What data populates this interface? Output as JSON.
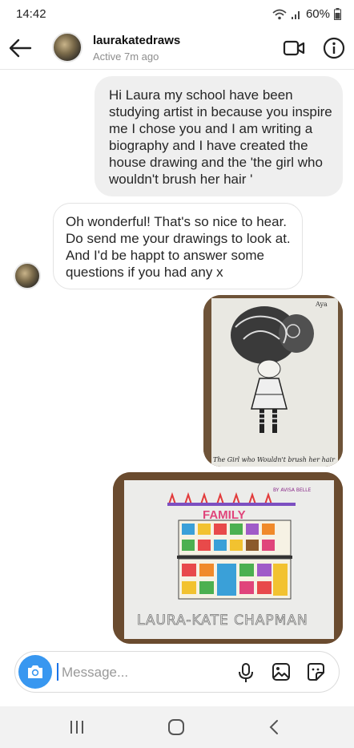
{
  "status_bar": {
    "time": "14:42",
    "battery": "60%"
  },
  "header": {
    "username": "laurakatedraws",
    "status": "Active 7m ago"
  },
  "messages": [
    {
      "direction": "outgoing",
      "text": "Hi Laura my school have been studying artist in because you inspire me I chose you and I am writing a biography and I have created the house drawing and the 'the girl who wouldn't brush her hair '"
    },
    {
      "direction": "incoming",
      "text": "Oh wonderful! That's so nice to hear. Do send me your drawings to look at. And I'd be happt to answer some questions if you had any x"
    }
  ],
  "photos": {
    "girl_drawing": {
      "caption": "The Girl who Wouldn't brush her hair",
      "signature": "Aya"
    },
    "house_drawing": {
      "title": "FAMILY",
      "signature": "BY AVISA BELLE",
      "caption": "LAURA-KATE CHAPMAN"
    }
  },
  "composer": {
    "placeholder": "Message..."
  },
  "colors": {
    "accent": "#3897f0",
    "outgoing_bubble": "#efefef"
  }
}
